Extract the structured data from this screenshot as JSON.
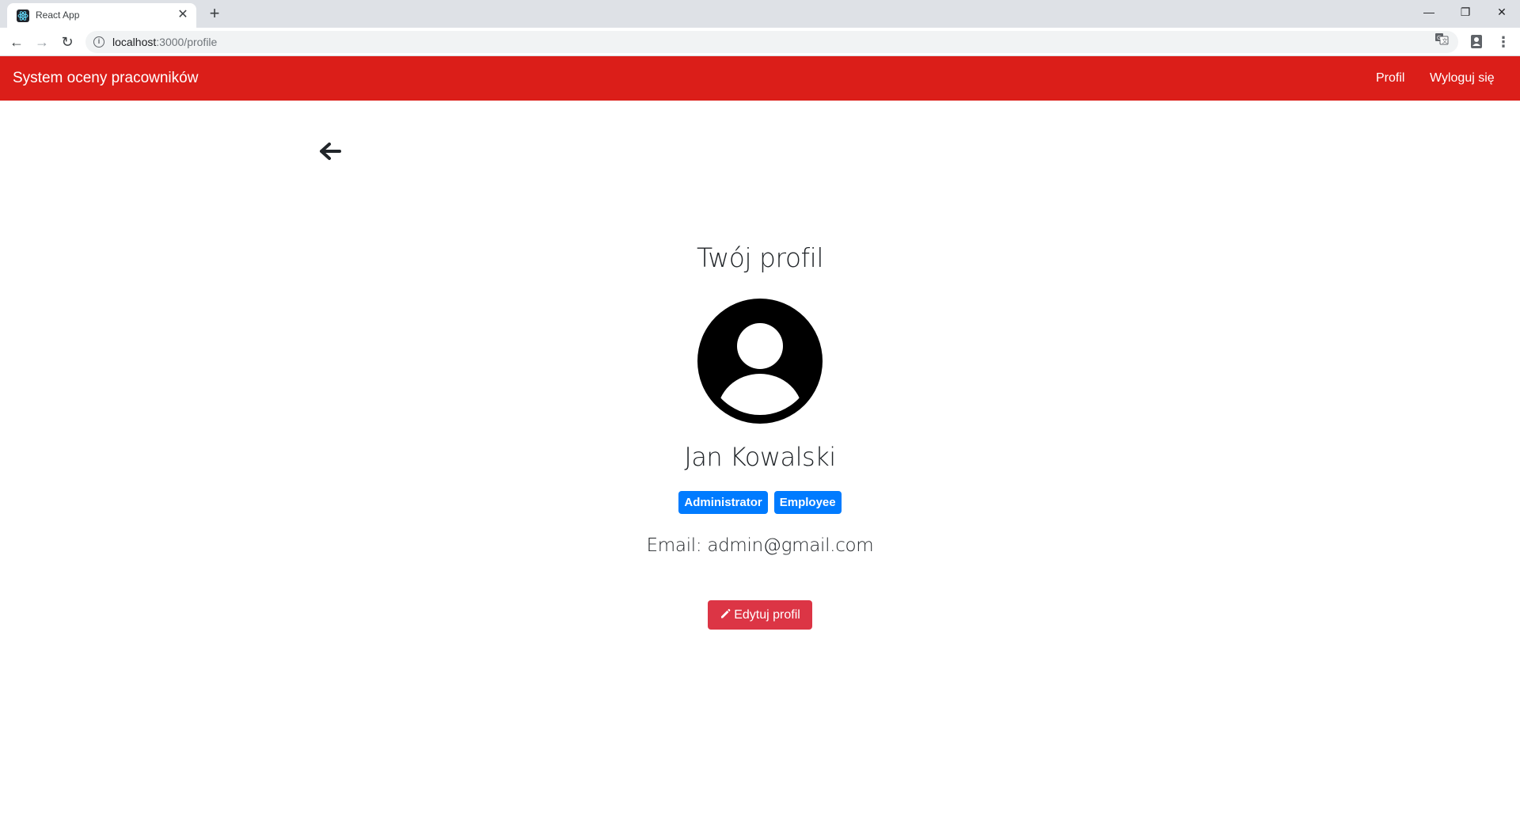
{
  "browser": {
    "tab_title": "React App",
    "tab_close": "✕",
    "new_tab": "+",
    "window_controls": {
      "minimize": "—",
      "maximize": "❐",
      "close": "✕"
    },
    "url_host": "localhost",
    "url_path": ":3000/profile",
    "nav": {
      "back": "←",
      "forward": "→",
      "reload": "↻",
      "menu": "⋮"
    }
  },
  "navbar": {
    "brand": "System oceny pracowników",
    "links": {
      "profile": "Profil",
      "logout": "Wyloguj się"
    },
    "color": "#db1e19"
  },
  "profile": {
    "title": "Twój profil",
    "name": "Jan Kowalski",
    "roles": [
      "Administrator",
      "Employee"
    ],
    "email": "Email: admin@gmail.com",
    "edit_button": "Edytuj profil"
  },
  "icons": {
    "back": "arrow-left-icon",
    "avatar": "user-circle-icon",
    "edit": "pencil-icon"
  },
  "colors": {
    "badge": "#007bff",
    "edit_button": "#dc3545"
  }
}
